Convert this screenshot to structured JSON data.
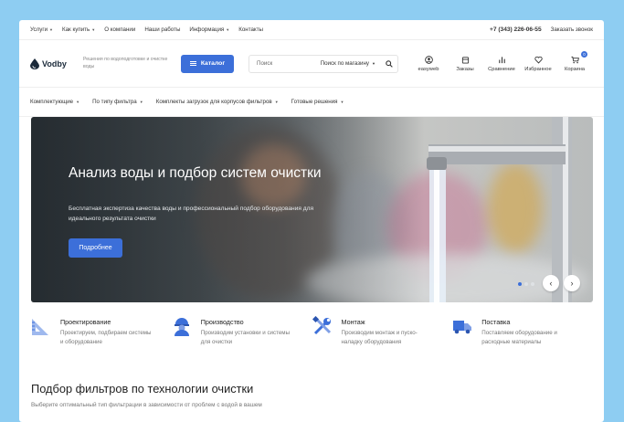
{
  "topbar": {
    "nav": [
      {
        "label": "Услуги",
        "dropdown": true
      },
      {
        "label": "Как купить",
        "dropdown": true
      },
      {
        "label": "О компании",
        "dropdown": false
      },
      {
        "label": "Наши работы",
        "dropdown": false
      },
      {
        "label": "Информация",
        "dropdown": true
      },
      {
        "label": "Контакты",
        "dropdown": false
      }
    ],
    "phone": "+7 (343) 226-06-55",
    "callback": "Заказать звонок"
  },
  "header": {
    "logo": "Vodby",
    "tagline": "Решения по водоподготовке и очистке воды",
    "catalog_label": "Каталог",
    "search_placeholder": "Поиск",
    "search_scope": "Поиск по магазину",
    "actions": [
      {
        "label": "easyweb",
        "icon": "user-icon"
      },
      {
        "label": "Заказы",
        "icon": "orders-icon"
      },
      {
        "label": "Сравнение",
        "icon": "compare-icon"
      },
      {
        "label": "Избранное",
        "icon": "heart-icon"
      },
      {
        "label": "Корзина",
        "icon": "cart-icon",
        "badge": "0"
      }
    ]
  },
  "categories": [
    "Комплектующие",
    "По типу фильтра",
    "Комплекты загрузок для корпусов фильтров",
    "Готовые решения"
  ],
  "hero": {
    "title": "Анализ воды и подбор систем очистки",
    "subtitle": "Бесплатная экспертиза качества воды и профессиональный подбор оборудования для идеального результата очистки",
    "cta": "Подробнее",
    "slides_total": 3,
    "slide_active": 1
  },
  "features": [
    {
      "title": "Проектирование",
      "text": "Проектируем, подбираем системы и оборудование",
      "icon": "ruler-triangle-icon",
      "color": "#3c6fd9"
    },
    {
      "title": "Производство",
      "text": "Производим установки и системы для очистки",
      "icon": "worker-helmet-icon",
      "color": "#3c6fd9"
    },
    {
      "title": "Монтаж",
      "text": "Производим монтаж и пуско-наладку оборудования",
      "icon": "tools-icon",
      "color": "#3c6fd9"
    },
    {
      "title": "Поставка",
      "text": "Поставляем оборудование и расходные материалы",
      "icon": "truck-icon",
      "color": "#3c6fd9"
    }
  ],
  "section": {
    "title": "Подбор фильтров по технологии очистки",
    "subtitle": "Выберите оптимальный тип фильтрации в зависимости от проблем с водой в вашем"
  }
}
